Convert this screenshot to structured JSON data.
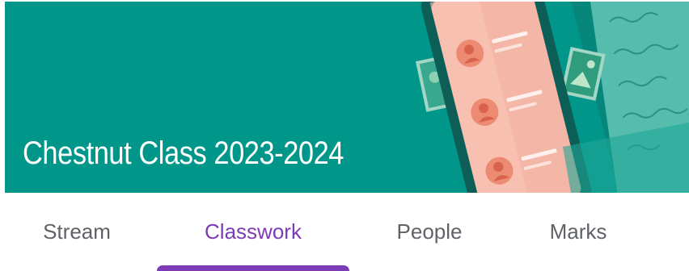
{
  "header": {
    "class_title": "Chestnut Class 2023-2024",
    "banner_color": "#00968a"
  },
  "tabs": [
    {
      "label": "Stream",
      "active": false
    },
    {
      "label": "Classwork",
      "active": true
    },
    {
      "label": "People",
      "active": false
    },
    {
      "label": "Marks",
      "active": false
    }
  ],
  "accent_color": "#7e3bb7",
  "illustration": {
    "icon": "phone-contacts-illustration"
  }
}
